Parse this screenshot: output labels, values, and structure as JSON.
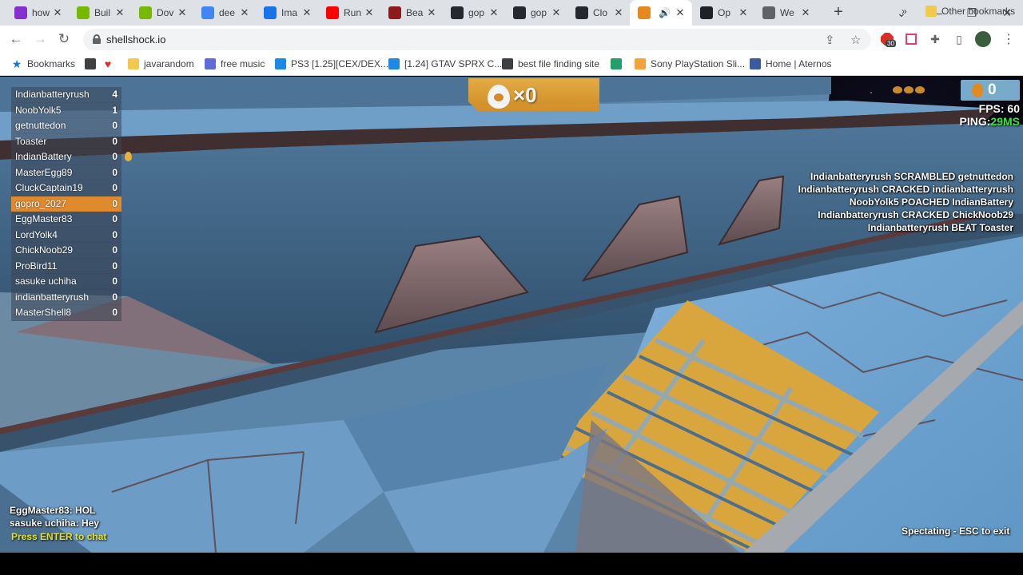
{
  "browser": {
    "tabs": [
      {
        "title": "how",
        "icon": "google-lens-icon",
        "color": "#8430ce"
      },
      {
        "title": "Buil",
        "icon": "nvidia-icon",
        "color": "#76b900"
      },
      {
        "title": "Dov",
        "icon": "nvidia-icon",
        "color": "#76b900"
      },
      {
        "title": "dee",
        "icon": "google-icon",
        "color": "#4285f4"
      },
      {
        "title": "Ima",
        "icon": "chart-icon",
        "color": "#1a73e8"
      },
      {
        "title": "Run",
        "icon": "youtube-icon",
        "color": "#ff0000"
      },
      {
        "title": "Bea",
        "icon": "medium-icon",
        "color": "#8b1a1a"
      },
      {
        "title": "gop",
        "icon": "github-icon",
        "color": "#24292f"
      },
      {
        "title": "gop",
        "icon": "github-icon",
        "color": "#24292f"
      },
      {
        "title": "Clo",
        "icon": "github-icon",
        "color": "#24292f"
      },
      {
        "title": "",
        "icon": "shellshock-icon",
        "color": "#e28a1f",
        "active": true
      },
      {
        "title": "Op",
        "icon": "openai-icon",
        "color": "#202124"
      },
      {
        "title": "We",
        "icon": "globe-icon",
        "color": "#5f6368"
      }
    ],
    "address": "shellshock.io",
    "extension_badge": "30",
    "bookmarks": [
      {
        "label": "Bookmarks",
        "icon": "star-icon",
        "color": "#1a73e8"
      },
      {
        "label": "",
        "icon": "soundcloud-icon",
        "color": "#3c4043"
      },
      {
        "label": "",
        "icon": "heart-icon",
        "color": "#d93025"
      },
      {
        "label": "javarandom",
        "icon": "folder-icon",
        "color": "#f2c94c"
      },
      {
        "label": "free music",
        "icon": "alien-icon",
        "color": "#5e6bd8"
      },
      {
        "label": "PS3 [1.25][CEX/DEX...",
        "icon": "c-icon",
        "color": "#1e88e5"
      },
      {
        "label": "[1.24] GTAV SPRX C...",
        "icon": "c-icon",
        "color": "#1e88e5"
      },
      {
        "label": "best file finding site",
        "icon": "briefcase-icon",
        "color": "#3c4043"
      },
      {
        "label": "",
        "icon": "square-icon",
        "color": "#22a06b"
      },
      {
        "label": "Sony PlayStation Sli...",
        "icon": "bag-icon",
        "color": "#f2a33a"
      },
      {
        "label": "Home | Aternos",
        "icon": "grid-icon",
        "color": "#3a5ba0"
      }
    ],
    "other_bookmarks": "Other bookmarks"
  },
  "game": {
    "scoreboard": [
      {
        "name": "Indianbatteryrush",
        "score": "4"
      },
      {
        "name": "NoobYolk5",
        "score": "1"
      },
      {
        "name": "getnuttedon",
        "score": "0"
      },
      {
        "name": "Toaster",
        "score": "0"
      },
      {
        "name": "IndianBattery",
        "score": "0"
      },
      {
        "name": "MasterEgg89",
        "score": "0"
      },
      {
        "name": "CluckCaptain19",
        "score": "0"
      },
      {
        "name": "gopro_2027",
        "score": "0",
        "highlight": true
      },
      {
        "name": "EggMaster83",
        "score": "0"
      },
      {
        "name": "LordYolk4",
        "score": "0"
      },
      {
        "name": "ChickNoob29",
        "score": "0"
      },
      {
        "name": "ProBird11",
        "score": "0"
      },
      {
        "name": "sasuke uchiha",
        "score": "0"
      },
      {
        "name": "indianbatteryrush",
        "score": "0"
      },
      {
        "name": "MasterShell8",
        "score": "0"
      }
    ],
    "kills": "×0",
    "eggs": "0",
    "fps_label": "FPS:",
    "fps": "60",
    "ping_label": "PING:",
    "ping": "29MS",
    "killfeed": [
      "Indianbatteryrush SCRAMBLED getnuttedon",
      "Indianbatteryrush CRACKED indianbatteryrush",
      "NoobYolk5 POACHED IndianBattery",
      "Indianbatteryrush CRACKED ChickNoob29",
      "Indianbatteryrush BEAT Toaster"
    ],
    "chat": [
      "EggMaster83: HOL",
      "sasuke uchiha: Hey"
    ],
    "chat_prompt": "Press ENTER to chat",
    "spectating": "Spectating - ESC to exit"
  }
}
